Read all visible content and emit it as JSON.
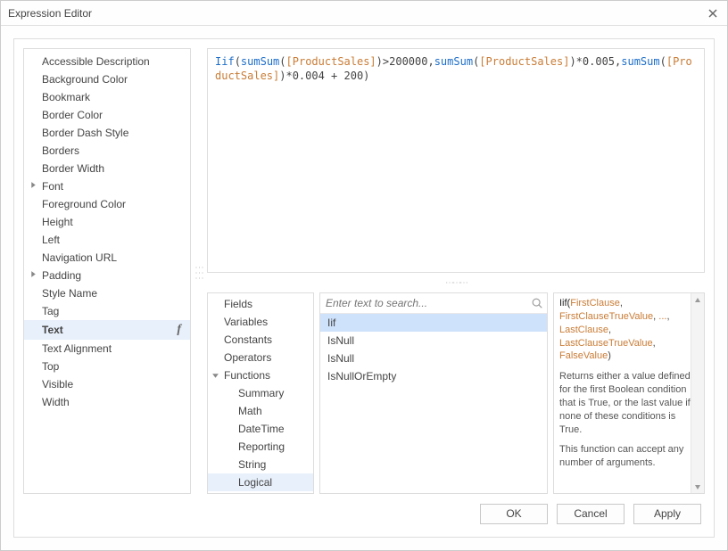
{
  "title": "Expression Editor",
  "properties": [
    {
      "label": "Accessible Description",
      "expandable": false
    },
    {
      "label": "Background Color",
      "expandable": false
    },
    {
      "label": "Bookmark",
      "expandable": false
    },
    {
      "label": "Border Color",
      "expandable": false
    },
    {
      "label": "Border Dash Style",
      "expandable": false
    },
    {
      "label": "Borders",
      "expandable": false
    },
    {
      "label": "Border Width",
      "expandable": false
    },
    {
      "label": "Font",
      "expandable": true
    },
    {
      "label": "Foreground Color",
      "expandable": false
    },
    {
      "label": "Height",
      "expandable": false
    },
    {
      "label": "Left",
      "expandable": false
    },
    {
      "label": "Navigation URL",
      "expandable": false
    },
    {
      "label": "Padding",
      "expandable": true
    },
    {
      "label": "Style Name",
      "expandable": false
    },
    {
      "label": "Tag",
      "expandable": false
    },
    {
      "label": "Text",
      "expandable": false,
      "selected": true,
      "fx": true
    },
    {
      "label": "Text Alignment",
      "expandable": false
    },
    {
      "label": "Top",
      "expandable": false
    },
    {
      "label": "Visible",
      "expandable": false
    },
    {
      "label": "Width",
      "expandable": false
    }
  ],
  "expression_tokens": [
    {
      "t": "Iif",
      "c": "kw"
    },
    {
      "t": "(",
      "c": ""
    },
    {
      "t": "sumSum",
      "c": "fn"
    },
    {
      "t": "(",
      "c": ""
    },
    {
      "t": "[ProductSales]",
      "c": "field"
    },
    {
      "t": ")>200000,",
      "c": ""
    },
    {
      "t": "sumSum",
      "c": "fn"
    },
    {
      "t": "(",
      "c": ""
    },
    {
      "t": "[ProductSales]",
      "c": "field"
    },
    {
      "t": ")*0.005,",
      "c": ""
    },
    {
      "t": "sumSum",
      "c": "fn"
    },
    {
      "t": "(",
      "c": ""
    },
    {
      "t": "[ProductSales]",
      "c": "field"
    },
    {
      "t": ")*0.004 + 200)",
      "c": ""
    }
  ],
  "categories": [
    {
      "label": "Fields",
      "level": 0
    },
    {
      "label": "Variables",
      "level": 0
    },
    {
      "label": "Constants",
      "level": 0
    },
    {
      "label": "Operators",
      "level": 0
    },
    {
      "label": "Functions",
      "level": 0,
      "expanded": true
    },
    {
      "label": "Summary",
      "level": 1
    },
    {
      "label": "Math",
      "level": 1
    },
    {
      "label": "DateTime",
      "level": 1
    },
    {
      "label": "Reporting",
      "level": 1
    },
    {
      "label": "String",
      "level": 1
    },
    {
      "label": "Logical",
      "level": 1,
      "selected": true
    }
  ],
  "search_placeholder": "Enter text to search...",
  "functions": [
    {
      "label": "Iif",
      "selected": true
    },
    {
      "label": "IsNull"
    },
    {
      "label": "IsNull"
    },
    {
      "label": "IsNullOrEmpty"
    }
  ],
  "description": {
    "sig_fn": "Iif",
    "sig_args": [
      "FirstClause",
      "FirstClauseTrueValue",
      "...",
      "LastClause",
      "LastClauseTrueValue",
      "FalseValue"
    ],
    "para1": "Returns either a value defined for the first Boolean condition that is True, or the last value if none of these conditions is True.",
    "para2": "This function can accept any number of arguments."
  },
  "buttons": {
    "ok": "OK",
    "cancel": "Cancel",
    "apply": "Apply"
  }
}
